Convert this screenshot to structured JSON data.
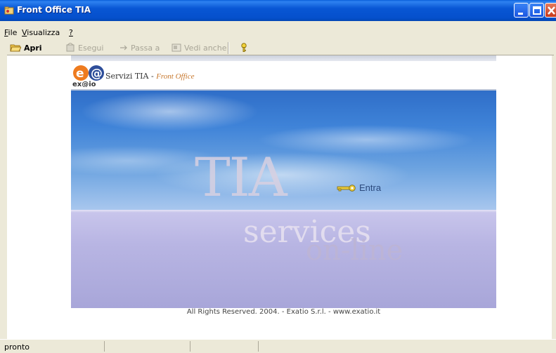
{
  "window": {
    "title": "Front Office TIA",
    "icons": {
      "app": "folder-key-icon",
      "minimize": "minimize-icon",
      "maximize": "maximize-icon",
      "close": "close-icon"
    }
  },
  "menu": {
    "file": {
      "accel": "F",
      "rest": "ile"
    },
    "view": {
      "accel": "V",
      "rest": "isualizza"
    },
    "help": {
      "accel": "?",
      "rest": ""
    }
  },
  "toolbar": {
    "open": {
      "label": "Apri",
      "icon": "open-folder-icon",
      "enabled": true
    },
    "run": {
      "label": "Esegui",
      "icon": "run-icon",
      "enabled": false
    },
    "goto": {
      "label": "Passa a",
      "icon": "arrow-right-icon",
      "enabled": false
    },
    "see_also": {
      "label": "Vedi anche",
      "icon": "see-also-icon",
      "enabled": false
    },
    "help": {
      "icon": "help-key-icon",
      "enabled": true
    }
  },
  "page": {
    "brand_main": "Servizi TIA",
    "brand_sep": " - ",
    "brand_sub": "Front Office",
    "logo_text": "ex@io",
    "hero_title": "TIA",
    "hero_services": "services",
    "hero_online": "on-line",
    "enter_label": "Entra",
    "enter_icon": "key-icon",
    "footer": "All Rights Reserved. 2004. - Exatio S.r.l. - www.exatio.it"
  },
  "status": {
    "text": "pronto"
  },
  "colors": {
    "titlebar": "#0550CC",
    "chrome": "#ECE9D8",
    "brand_accent": "#C7772C",
    "enter_text": "#2C4A7D"
  }
}
